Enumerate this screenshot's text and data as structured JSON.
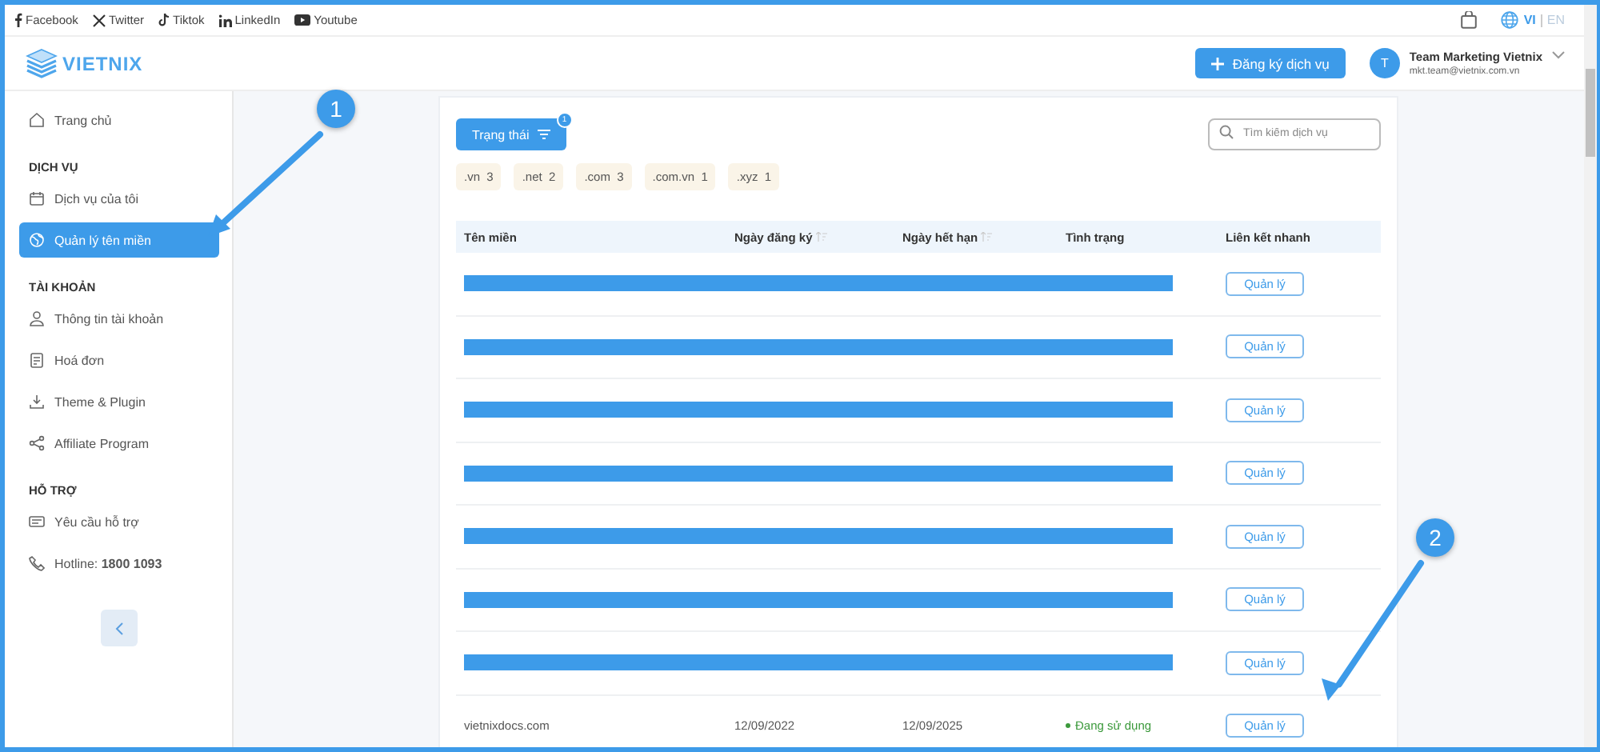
{
  "social_links": [
    {
      "kind": "facebook",
      "label": "Facebook"
    },
    {
      "kind": "twitter",
      "label": "Twitter"
    },
    {
      "kind": "tiktok",
      "label": "Tiktok"
    },
    {
      "kind": "linkedin",
      "label": "LinkedIn"
    },
    {
      "kind": "youtube",
      "label": "Youtube"
    }
  ],
  "languages": [
    {
      "label": "VI",
      "selected": true
    },
    {
      "label": "EN",
      "selected": false
    }
  ],
  "logo": {
    "text": "VIETNIX"
  },
  "register_button": {
    "label": "Đăng ký dịch vụ"
  },
  "user": {
    "initial": "T",
    "name": "Team Marketing Vietnix",
    "email": "mkt.team@vietnix.com.vn"
  },
  "sidebar": {
    "sections": [
      {
        "items": [
          {
            "kind": "home",
            "label": "Trang chủ",
            "selected": false
          }
        ]
      },
      {
        "heading": "DỊCH VỤ",
        "items": [
          {
            "kind": "box",
            "label": "Dịch vụ của tôi",
            "selected": false
          },
          {
            "kind": "globe",
            "label": "Quản lý tên miền",
            "selected": true
          }
        ]
      },
      {
        "heading": "TÀI KHOẢN",
        "items": [
          {
            "kind": "user",
            "label": "Thông tin tài khoản",
            "selected": false
          },
          {
            "kind": "invoice",
            "label": "Hoá đơn",
            "selected": false
          },
          {
            "kind": "download",
            "label": "Theme & Plugin",
            "selected": false
          },
          {
            "kind": "share",
            "label": "Affiliate Program",
            "selected": false
          }
        ]
      },
      {
        "heading": "HỖ TRỢ",
        "items": [
          {
            "kind": "ticket",
            "label": "Yêu cầu hỗ trợ",
            "selected": false
          },
          {
            "kind": "phone",
            "label": "Hotline: **1800 1093**",
            "selected": false
          }
        ]
      }
    ]
  },
  "filter": {
    "label": "Trạng thái",
    "badge": "1"
  },
  "search": {
    "placeholder": "Tìm kiếm dịch vụ"
  },
  "tags": [
    {
      "label": ".vn",
      "count": "3"
    },
    {
      "label": ".net",
      "count": "2"
    },
    {
      "label": ".com",
      "count": "3"
    },
    {
      "label": ".com.vn",
      "count": "1"
    },
    {
      "label": ".xyz",
      "count": "1"
    }
  ],
  "table": {
    "columns": [
      {
        "label": "Tên miền",
        "sortable": false
      },
      {
        "label": "Ngày đăng ký",
        "sortable": true
      },
      {
        "label": "Ngày hết hạn",
        "sortable": true
      },
      {
        "label": "Tình trạng",
        "sortable": false
      },
      {
        "label": "Liên kết nhanh",
        "sortable": false
      }
    ],
    "rows": [
      {
        "kind": "redacted",
        "action": "Quản lý"
      },
      {
        "kind": "redacted",
        "action": "Quản lý"
      },
      {
        "kind": "redacted",
        "action": "Quản lý"
      },
      {
        "kind": "redacted",
        "action": "Quản lý"
      },
      {
        "kind": "redacted",
        "action": "Quản lý"
      },
      {
        "kind": "redacted",
        "action": "Quản lý"
      },
      {
        "kind": "redacted",
        "action": "Quản lý"
      },
      {
        "kind": "domain",
        "domain": "vietnixdocs.com",
        "registered": "12/09/2022",
        "expires": "12/09/2025",
        "status": "Đang sử dụng",
        "action": "Quản lý"
      }
    ]
  },
  "callouts": [
    {
      "number": "1"
    },
    {
      "number": "2"
    }
  ]
}
